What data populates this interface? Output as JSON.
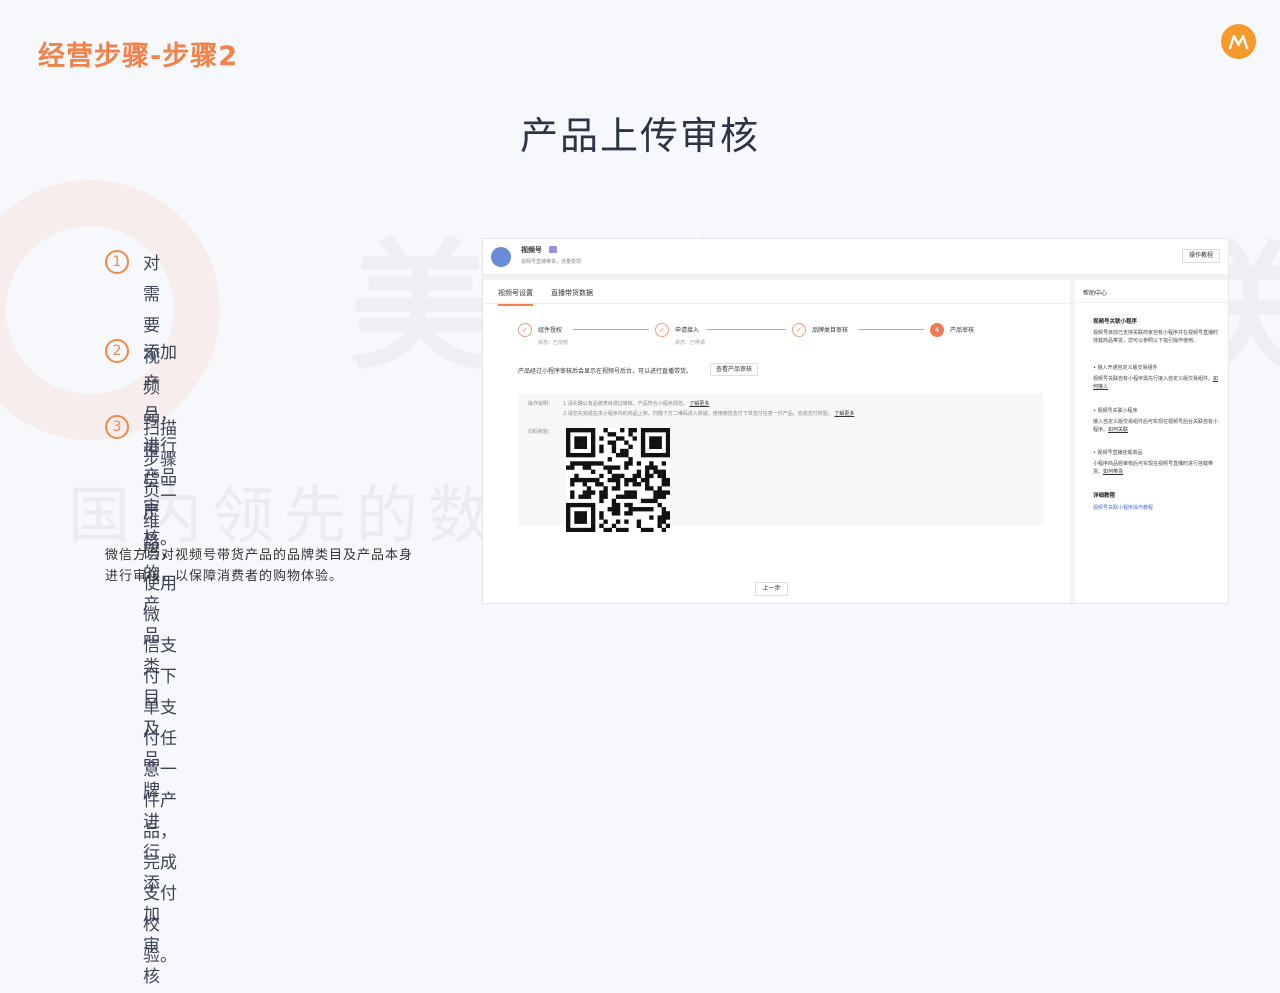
{
  "slide": {
    "title": "经营步骤-步骤2",
    "heading": "产品上传审核",
    "watermark_big": "美 蜂 互 联",
    "watermark_sub": "国内领先的数字化营销服务商",
    "steps": [
      {
        "num": "1",
        "lines": [
          "对需要视频号带货产品的产品类目及品",
          "牌进行添加审核"
        ]
      },
      {
        "num": "2",
        "lines": [
          "添加产品，进行产品审核。"
        ]
      },
      {
        "num": "3",
        "lines": [
          "扫描步骤页二维码，使用微",
          "信支付下单支付任意一件产",
          "品，完成支付校验。"
        ]
      }
    ],
    "note": [
      "微信方会对视频号带货产品的品牌类目及产品本身",
      "进行审核，以保障消费者的购物体验。"
    ],
    "accent": "#f0824a"
  },
  "screenshot": {
    "app_name": "视频号",
    "app_desc": "视频号直播带货，流量变现",
    "tutorial_button": "操作教程",
    "tabs": [
      "视频号设置",
      "直播带货数据"
    ],
    "stepper": [
      {
        "num": "✓",
        "label": "组件授权",
        "status": "状态：已授权"
      },
      {
        "num": "✓",
        "label": "申请接入",
        "status": "状态：已申请"
      },
      {
        "num": "✓",
        "label": "品牌类目审核",
        "status": ""
      },
      {
        "num": "4",
        "label": "产品审核",
        "status": ""
      }
    ],
    "sub_text": "产品经过小程序审核后会显示在视频号后台，可以进行直播带货。",
    "view_audit_button": "查看产品审核",
    "info_label": "操作说明：",
    "info_line1": "1.请先确认有品牌类目通过审核，产品符合小程序规范。",
    "info_line1_link": "了解更多",
    "info_line2": "2.请您先完成在本小程序内的商品上架，扫描下方二维码进入商城，使用微信支付下单支付任意一件产品，完成支付校验。",
    "info_line2_link": "了解更多",
    "scan_label": "扫码校验：",
    "back_button": "上一步",
    "help": {
      "title": "帮助中心",
      "sections": [
        {
          "head": "视频号关联小程序",
          "body": "视频号目前已支持关联商家自有小程序并在视频号直播时挂载商品带货，您可以参照以下指引操作使用。",
          "link": ""
        },
        {
          "head": "• 接入开通自定义版交易组件",
          "body": "视频号关联自有小程序需先行接入自定义版交易组件。",
          "link": "如何接入"
        },
        {
          "head": "• 视频号关联小程序",
          "body": "接入自定义版交易组件后可实现在视频号后台关联自有小程序。",
          "link": "如何关联"
        },
        {
          "head": "• 视频号直播挂载商品",
          "body": "小程序商品经审核后可实现在视频号直播时进行挂载带货。",
          "link": "如何带货"
        }
      ],
      "detail_head": "详细教程",
      "detail_link": "视频号关联小程序操作教程"
    }
  }
}
